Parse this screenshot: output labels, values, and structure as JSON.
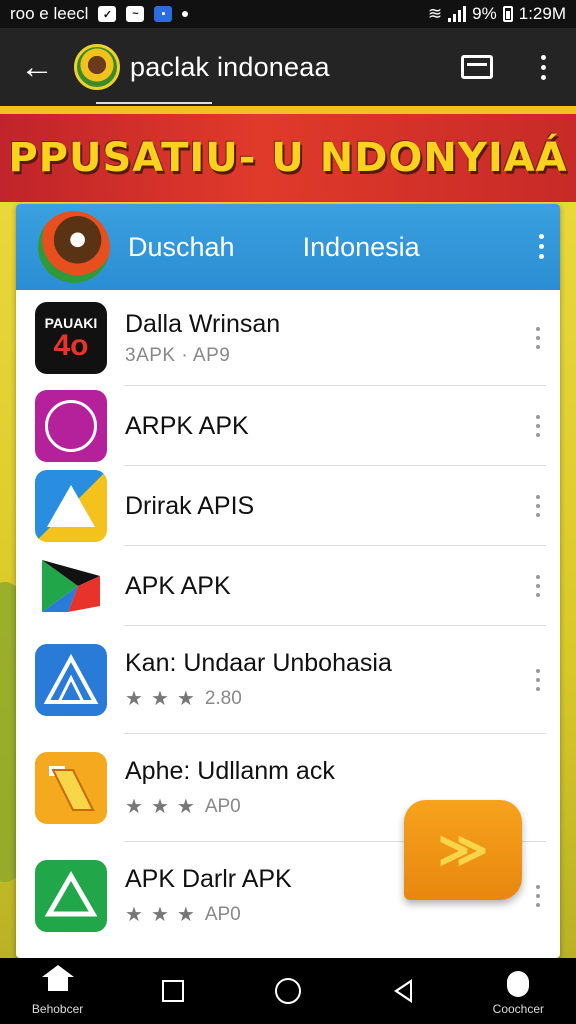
{
  "status_bar": {
    "left_text": "roo e leecl",
    "battery_percent": "9%",
    "time": "1:29M"
  },
  "app_bar": {
    "title": "paclak indoneaa"
  },
  "banner": {
    "text": "PPUSATIU- U NDONYIAÁ"
  },
  "card_header": {
    "left": "Duschah",
    "right": "Indonesia"
  },
  "list": [
    {
      "name": "Dalla Wrinsan",
      "sub": "3APK · AP9",
      "icon_text": "PAUAKI",
      "icon_num": "4o"
    },
    {
      "name": "ARPK APK"
    },
    {
      "name": "Drirak APIS"
    },
    {
      "name": "APK APK"
    },
    {
      "name": "Kan: Undaar Unbohasia",
      "rating_text": "2.80"
    },
    {
      "name": "Aphe: Udllanm ack",
      "rating_text": "AP0"
    },
    {
      "name": "APK Darlr APK",
      "rating_text": "AP0"
    }
  ],
  "nav": {
    "home_label": "Behobcer",
    "voice_label": "Coochcer"
  },
  "colors": {
    "header_blue": "#2b8ed4",
    "banner_red": "#c72a28",
    "banner_yellow": "#f8d21c",
    "fab_orange": "#f7a21c"
  }
}
